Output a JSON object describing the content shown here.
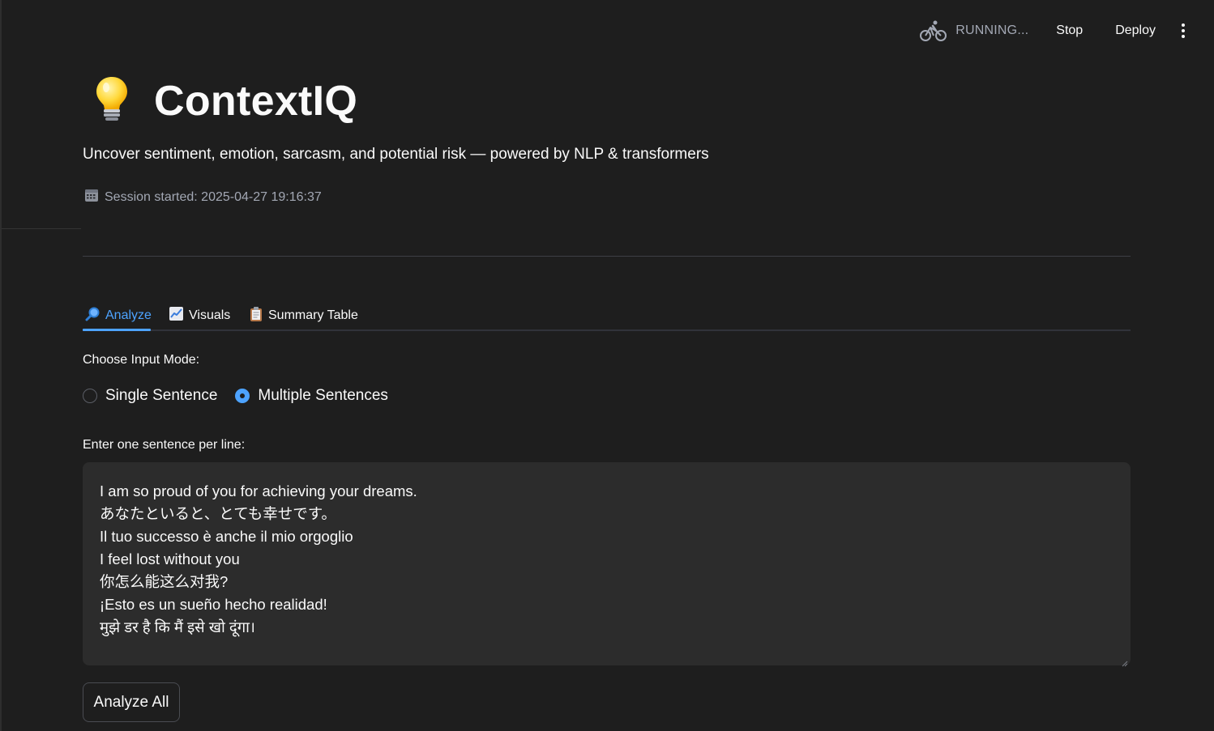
{
  "toolbar": {
    "status_text": "RUNNING...",
    "stop_label": "Stop",
    "deploy_label": "Deploy",
    "status_icon": "bicycle-icon",
    "menu_icon": "kebab-menu-icon"
  },
  "header": {
    "icon": "lightbulb-icon",
    "title": "ContextIQ",
    "subtitle": "Uncover sentiment, emotion, sarcasm, and potential risk — powered by NLP & transformers",
    "session_icon": "calendar-icon",
    "session_text": "Session started: 2025-04-27 19:16:37"
  },
  "tabs": [
    {
      "label": "Analyze",
      "icon": "magnifier-icon",
      "active": true
    },
    {
      "label": "Visuals",
      "icon": "chart-icon",
      "active": false
    },
    {
      "label": "Summary Table",
      "icon": "clipboard-icon",
      "active": false
    }
  ],
  "input_mode": {
    "label": "Choose Input Mode:",
    "options": [
      "Single Sentence",
      "Multiple Sentences"
    ],
    "selected": "Multiple Sentences"
  },
  "sentences": {
    "label": "Enter one sentence per line:",
    "lines": [
      "I am so proud of you for achieving your dreams.",
      "あなたといると、とても幸せです。",
      "Il tuo successo è anche il mio orgoglio",
      "I feel lost without you",
      "你怎么能这么对我?",
      "¡Esto es un sueño hecho realidad!",
      "मुझे डर है कि मैं इसे खो दूंगा।"
    ]
  },
  "actions": {
    "analyze_label": "Analyze All"
  },
  "colors": {
    "background": "#1e1e1e",
    "accent": "#4da3ff",
    "textarea_bg": "#2c2c2c",
    "muted_text": "#a3a8b4"
  }
}
